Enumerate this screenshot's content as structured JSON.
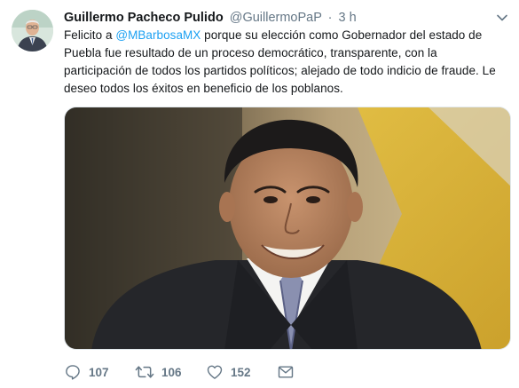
{
  "tweet": {
    "author_name": "Guillermo Pacheco Pulido",
    "author_handle": "@GuillermoPaP",
    "separator": "·",
    "time": "3 h",
    "text": {
      "before_mention": "Felicito a ",
      "mention": "@MBarbosaMX",
      "after_mention": " porque su elección como Gobernador del estado de Puebla fue resultado de un proceso democrático, transparente, con la participación de todos los partidos políticos; alejado de todo indicio de fraude. Le deseo todos los éxitos en beneficio de los poblanos."
    },
    "actions": {
      "reply_count": "107",
      "retweet_count": "106",
      "like_count": "152"
    }
  },
  "icons": {
    "reply": "reply-icon",
    "retweet": "retweet-icon",
    "like": "heart-icon",
    "message": "envelope-icon",
    "caret": "chevron-down-icon"
  },
  "colors": {
    "link": "#1da1f2",
    "secondary_text": "#657786",
    "primary_text": "#14171a",
    "background": "#ffffff"
  }
}
